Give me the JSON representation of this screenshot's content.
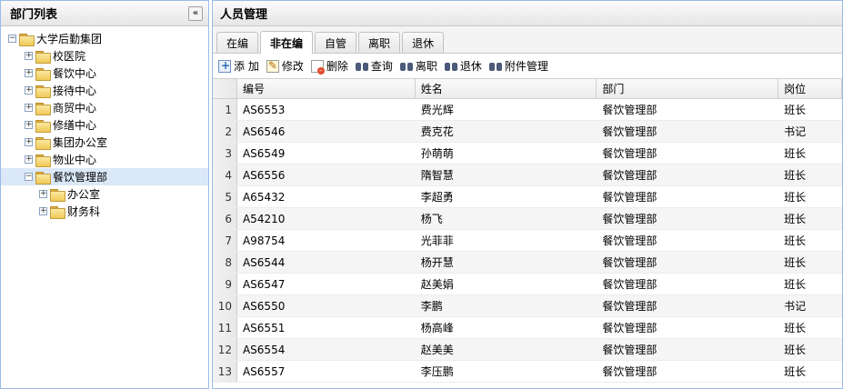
{
  "left_panel": {
    "title": "部门列表",
    "collapse_glyph": "«",
    "tree": [
      {
        "label": "大学后勤集团",
        "level": 0,
        "expander": "−"
      },
      {
        "label": "校医院",
        "level": 1,
        "expander": "+"
      },
      {
        "label": "餐饮中心",
        "level": 1,
        "expander": "+"
      },
      {
        "label": "接待中心",
        "level": 1,
        "expander": "+"
      },
      {
        "label": "商贸中心",
        "level": 1,
        "expander": "+"
      },
      {
        "label": "修缮中心",
        "level": 1,
        "expander": "+"
      },
      {
        "label": "集团办公室",
        "level": 1,
        "expander": "+"
      },
      {
        "label": "物业中心",
        "level": 1,
        "expander": "+"
      },
      {
        "label": "餐饮管理部",
        "level": 1,
        "expander": "−",
        "selected": true
      },
      {
        "label": "办公室",
        "level": 2,
        "expander": "+"
      },
      {
        "label": "财务科",
        "level": 2,
        "expander": "+"
      }
    ]
  },
  "right_panel": {
    "title": "人员管理",
    "tabs": [
      {
        "label": "在编",
        "active": false
      },
      {
        "label": "非在编",
        "active": true
      },
      {
        "label": "自管",
        "active": false
      },
      {
        "label": "离职",
        "active": false
      },
      {
        "label": "退休",
        "active": false
      }
    ],
    "toolbar": [
      {
        "label": "添 加",
        "icon": "add-icon"
      },
      {
        "label": "修改",
        "icon": "edit-icon"
      },
      {
        "label": "删除",
        "icon": "delete-icon"
      },
      {
        "label": "查询",
        "icon": "search-icon"
      },
      {
        "label": "离职",
        "icon": "resign-icon"
      },
      {
        "label": "退休",
        "icon": "retire-icon"
      },
      {
        "label": "附件管理",
        "icon": "attachment-icon"
      }
    ],
    "grid": {
      "columns": [
        "编号",
        "姓名",
        "部门",
        "岗位"
      ],
      "rows": [
        [
          "1",
          "AS6553",
          "费光辉",
          "餐饮管理部",
          "班长"
        ],
        [
          "2",
          "AS6546",
          "费克花",
          "餐饮管理部",
          "书记"
        ],
        [
          "3",
          "AS6549",
          "孙萌萌",
          "餐饮管理部",
          "班长"
        ],
        [
          "4",
          "AS6556",
          "隋智慧",
          "餐饮管理部",
          "班长"
        ],
        [
          "5",
          "A65432",
          "李超勇",
          "餐饮管理部",
          "班长"
        ],
        [
          "6",
          "A54210",
          "杨飞",
          "餐饮管理部",
          "班长"
        ],
        [
          "7",
          "A98754",
          "光菲菲",
          "餐饮管理部",
          "班长"
        ],
        [
          "8",
          "AS6544",
          "杨开慧",
          "餐饮管理部",
          "班长"
        ],
        [
          "9",
          "AS6547",
          "赵美娟",
          "餐饮管理部",
          "班长"
        ],
        [
          "10",
          "AS6550",
          "李鹏",
          "餐饮管理部",
          "书记"
        ],
        [
          "11",
          "AS6551",
          "杨高峰",
          "餐饮管理部",
          "班长"
        ],
        [
          "12",
          "AS6554",
          "赵美美",
          "餐饮管理部",
          "班长"
        ],
        [
          "13",
          "AS6557",
          "李压鹏",
          "餐饮管理部",
          "班长"
        ]
      ]
    }
  }
}
